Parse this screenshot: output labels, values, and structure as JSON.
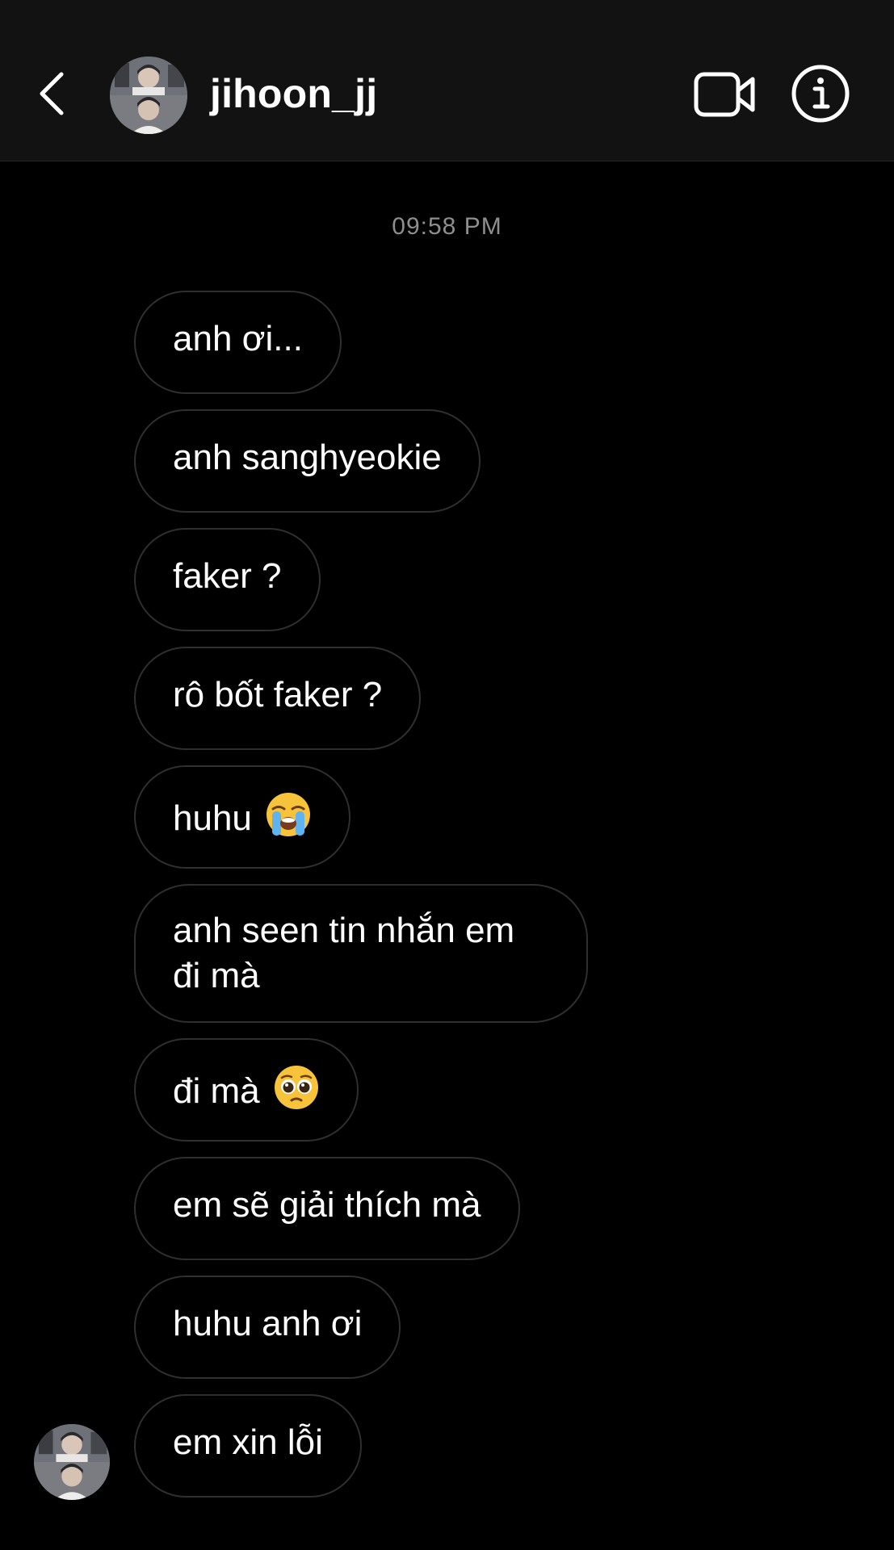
{
  "header": {
    "username": "jihoon_jj",
    "icons": {
      "back": "chevron-left-icon",
      "video": "video-call-icon",
      "info": "info-icon"
    }
  },
  "thread": {
    "timestamp": "09:58 PM",
    "messages": [
      {
        "text": "anh ơi..."
      },
      {
        "text": "anh sanghyeokie"
      },
      {
        "text": "faker ?"
      },
      {
        "text": "rô bốt faker ?"
      },
      {
        "text": "huhu",
        "emoji": "loudly-crying-face"
      },
      {
        "text": "anh seen tin nhắn em đi mà"
      },
      {
        "text": "đi mà",
        "emoji": "pleading-face"
      },
      {
        "text": "em sẽ giải thích mà"
      },
      {
        "text": "huhu anh ơi"
      },
      {
        "text": "em xin lỗi"
      }
    ]
  },
  "colors": {
    "background": "#000000",
    "header_bg": "#121212",
    "bubble_border": "#2f2f2f",
    "timestamp": "#8e8e8e",
    "text": "#ffffff"
  }
}
